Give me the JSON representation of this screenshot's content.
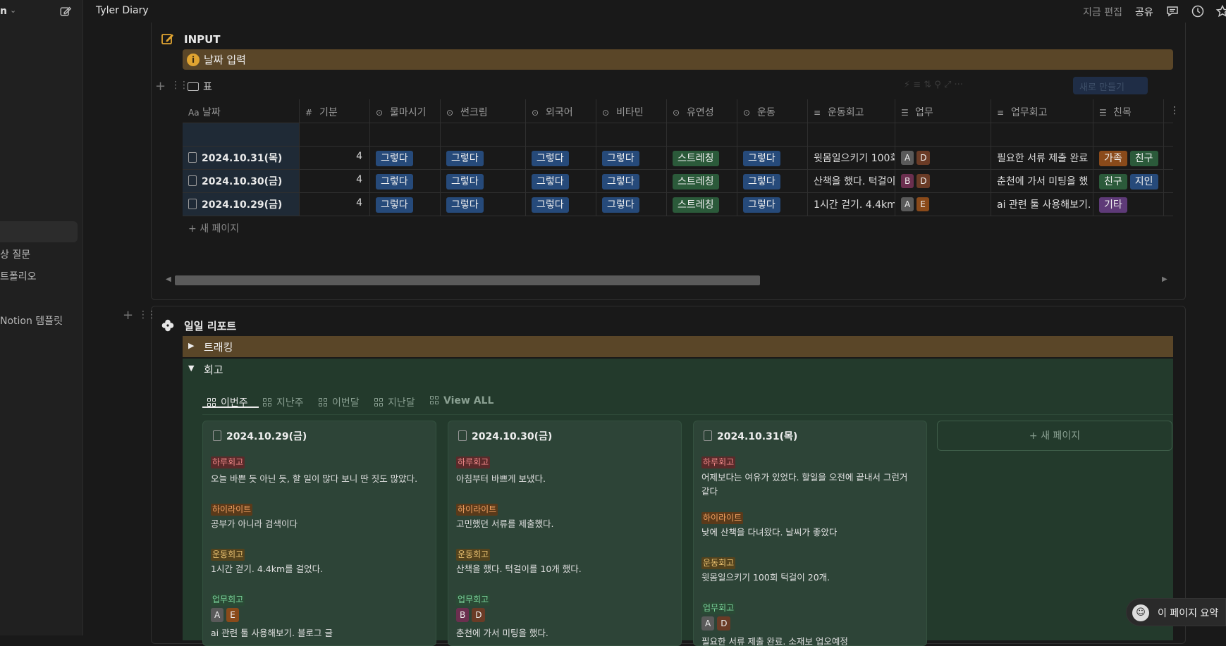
{
  "sidebar": {
    "workspace": "n",
    "items": [
      "상 질문",
      "트폴리오",
      "Notion 템플릿"
    ]
  },
  "topbar": {
    "title": "Tyler Diary",
    "edited": "지금 편집",
    "share": "공유"
  },
  "input_block": {
    "title": "INPUT",
    "callout": "날짜 입력",
    "view_tab": "표",
    "new_button": "새로 만들기",
    "columns": [
      "날짜",
      "기분",
      "물마시기",
      "썬크림",
      "외국어",
      "비타민",
      "유연성",
      "운동",
      "운동회고",
      "업무",
      "업무회고",
      "친목"
    ],
    "rows": [
      {
        "date": "2024.10.31(목)",
        "mood": "4",
        "water": "그렇다",
        "sun": "그렇다",
        "lang": "그렇다",
        "vit": "그렇다",
        "flex": "스트레칭",
        "ex": "그렇다",
        "ex_review": "윗몸일으키기 100회",
        "work": [
          "A",
          "D"
        ],
        "work_review": "필요한 서류 제출 완료",
        "social": [
          "가족",
          "친구"
        ]
      },
      {
        "date": "2024.10.30(금)",
        "mood": "4",
        "water": "그렇다",
        "sun": "그렇다",
        "lang": "그렇다",
        "vit": "그렇다",
        "flex": "스트레칭",
        "ex": "그렇다",
        "ex_review": "산책을 했다. 턱걸이",
        "work": [
          "B",
          "D"
        ],
        "work_review": "춘천에 가서 미팅을 했",
        "social": [
          "친구",
          "지인"
        ]
      },
      {
        "date": "2024.10.29(금)",
        "mood": "4",
        "water": "그렇다",
        "sun": "그렇다",
        "lang": "그렇다",
        "vit": "그렇다",
        "flex": "스트레칭",
        "ex": "그렇다",
        "ex_review": "1시간 걷기. 4.4km를",
        "work": [
          "A",
          "E"
        ],
        "work_review": "ai 관련 툴 사용해보기.",
        "social": [
          "기타"
        ]
      }
    ],
    "new_page": "새 페이지"
  },
  "report_block": {
    "title": "일일 리포트",
    "toggle1": "트래킹",
    "toggle2": "회고",
    "tabs": [
      "이번주",
      "지난주",
      "이번달",
      "지난달",
      "View ALL"
    ],
    "add_card": "+ 새 페이지",
    "labels": {
      "daily": "하루회고",
      "highlight": "하이라이트",
      "exercise": "운동회고",
      "work": "업무회고"
    },
    "cards": [
      {
        "date": "2024.10.29(금)",
        "daily": "오늘 바쁜 듯 아닌 듯, 할 일이 많다 보니 딴 짓도 많았다.",
        "highlight": "공부가 아니라 검색이다",
        "exercise": "1시간 걷기. 4.4km를 걸었다.",
        "work_tags": [
          "A",
          "E"
        ],
        "work": "ai 관련 툴 사용해보기. 블로그 글"
      },
      {
        "date": "2024.10.30(금)",
        "daily": "아침부터 바쁘게 보냈다.",
        "highlight": "고민했던 서류를 제출했다.",
        "exercise": "산책을 했다. 턱걸이를 10개 했다.",
        "work_tags": [
          "B",
          "D"
        ],
        "work": "춘천에 가서 미팅을 했다."
      },
      {
        "date": "2024.10.31(목)",
        "daily": "어제보다는 여유가 있었다. 할일을 오전에 끝내서 그런거 같다",
        "highlight": "낮에 산책을 다녀왔다. 날씨가 좋았다",
        "exercise": "윗몸일으키기 100회 턱걸이 20개.",
        "work_tags": [
          "A",
          "D"
        ],
        "work": "필요한 서류 제출 완료. 소재보 업오예정"
      }
    ]
  },
  "summary": {
    "label": "이 페이지 요약"
  }
}
